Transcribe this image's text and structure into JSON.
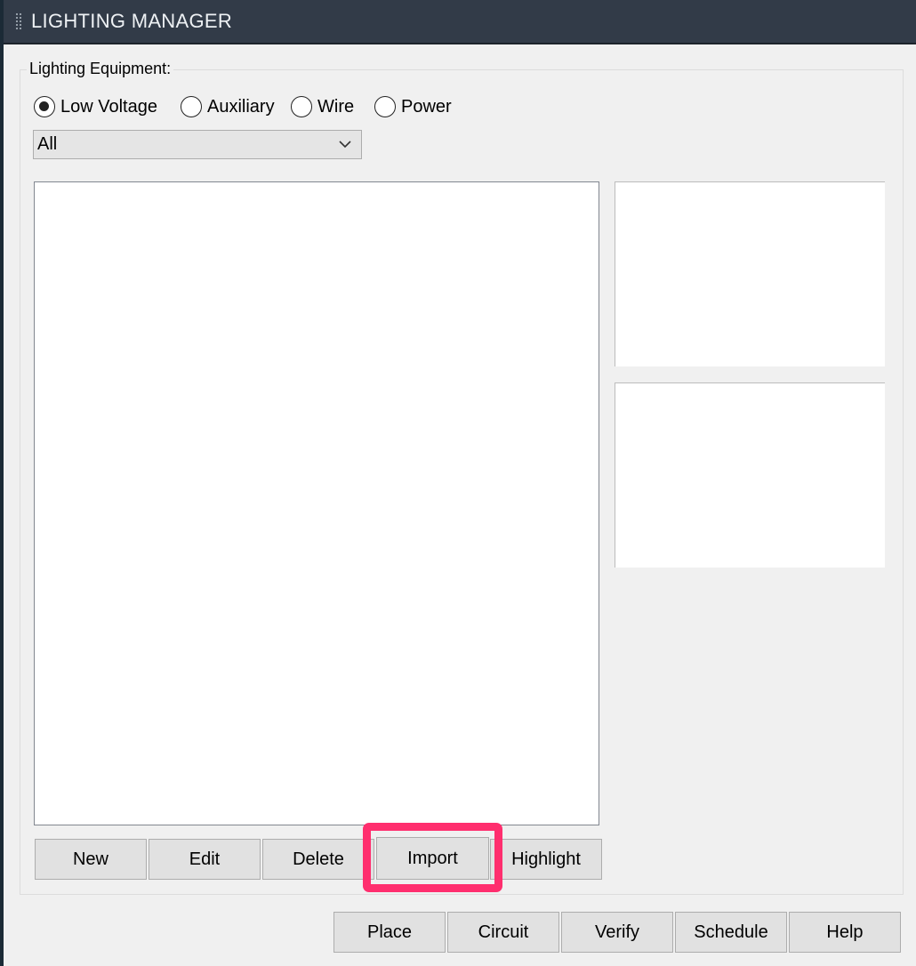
{
  "window": {
    "title": "LIGHTING MANAGER"
  },
  "group": {
    "label": "Lighting Equipment:"
  },
  "radios": [
    {
      "label": "Low Voltage",
      "checked": true
    },
    {
      "label": "Auxiliary",
      "checked": false
    },
    {
      "label": "Wire",
      "checked": false
    },
    {
      "label": "Power",
      "checked": false
    }
  ],
  "filter": {
    "selected": "All"
  },
  "list_buttons": {
    "new": "New",
    "edit": "Edit",
    "delete": "Delete",
    "import": "Import",
    "highlight": "Highlight"
  },
  "footer_buttons": {
    "place": "Place",
    "circuit": "Circuit",
    "verify": "Verify",
    "schedule": "Schedule",
    "help": "Help"
  },
  "colors": {
    "titlebar": "#323b48",
    "highlight_annotation": "#ff2e6e"
  }
}
